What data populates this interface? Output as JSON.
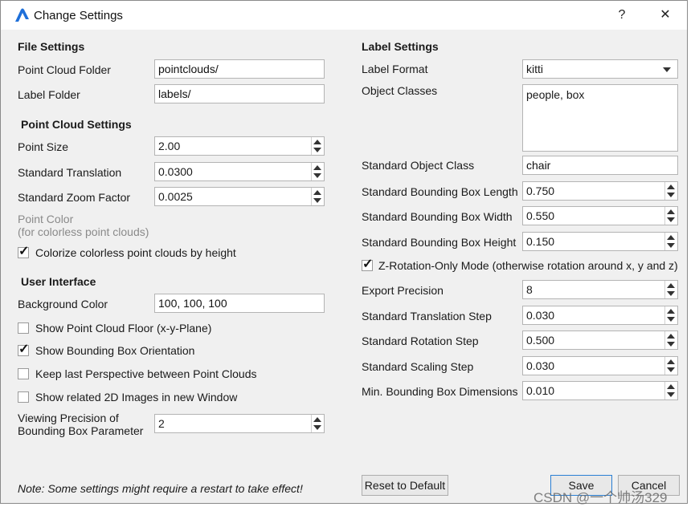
{
  "window": {
    "title": "Change Settings",
    "help_label": "?",
    "close_label": "✕"
  },
  "file_settings": {
    "header": "File Settings",
    "point_cloud_folder": {
      "label": "Point Cloud Folder",
      "value": "pointclouds/"
    },
    "label_folder": {
      "label": "Label Folder",
      "value": "labels/"
    }
  },
  "point_cloud_settings": {
    "header": "Point Cloud Settings",
    "point_size": {
      "label": "Point Size",
      "value": "2.00"
    },
    "standard_translation": {
      "label": "Standard Translation",
      "value": "0.0300"
    },
    "standard_zoom_factor": {
      "label": "Standard Zoom Factor",
      "value": "0.0025"
    },
    "point_color": {
      "label_line1": "Point Color",
      "label_line2": "(for colorless point clouds)"
    },
    "colorize_by_height": {
      "label": "Colorize colorless point clouds by height",
      "checked": true
    }
  },
  "user_interface": {
    "header": "User Interface",
    "background_color": {
      "label": "Background Color",
      "value": "100, 100, 100"
    },
    "show_floor": {
      "label": "Show Point Cloud Floor (x-y-Plane)",
      "checked": false
    },
    "show_orientation": {
      "label": "Show Bounding Box Orientation",
      "checked": true
    },
    "keep_perspective": {
      "label": "Keep last Perspective between Point Clouds",
      "checked": false
    },
    "show_2d_images": {
      "label": "Show related 2D Images in new Window",
      "checked": false
    },
    "viewing_precision": {
      "label_line1": "Viewing Precision of",
      "label_line2": "Bounding Box Parameter",
      "value": "2"
    }
  },
  "label_settings": {
    "header": "Label Settings",
    "label_format": {
      "label": "Label Format",
      "value": "kitti"
    },
    "object_classes": {
      "label": "Object Classes",
      "value": "people, box"
    },
    "standard_object_class": {
      "label": "Standard Object Class",
      "value": "chair"
    },
    "bbox_length": {
      "label": "Standard Bounding Box Length",
      "value": "0.750"
    },
    "bbox_width": {
      "label": "Standard Bounding Box Width",
      "value": "0.550"
    },
    "bbox_height": {
      "label": "Standard Bounding Box Height",
      "value": "0.150"
    },
    "z_rotation_only": {
      "label": "Z-Rotation-Only Mode (otherwise rotation around x, y and z)",
      "checked": true
    },
    "export_precision": {
      "label": "Export Precision",
      "value": "8"
    },
    "translation_step": {
      "label": "Standard Translation Step",
      "value": "0.030"
    },
    "rotation_step": {
      "label": "Standard Rotation Step",
      "value": "0.500"
    },
    "scaling_step": {
      "label": "Standard Scaling Step",
      "value": "0.030"
    },
    "min_bbox_dimensions": {
      "label": "Min. Bounding Box Dimensions",
      "value": "0.010"
    }
  },
  "footer": {
    "note": "Note: Some settings might require a restart to take effect!",
    "reset_label": "Reset to Default",
    "save_label": "Save",
    "cancel_label": "Cancel"
  },
  "watermark": "CSDN @一个帅汤329",
  "colors": {
    "accent": "#2a7fd4",
    "app_icon": "#1e6fd9",
    "checkmark": "#111111"
  }
}
